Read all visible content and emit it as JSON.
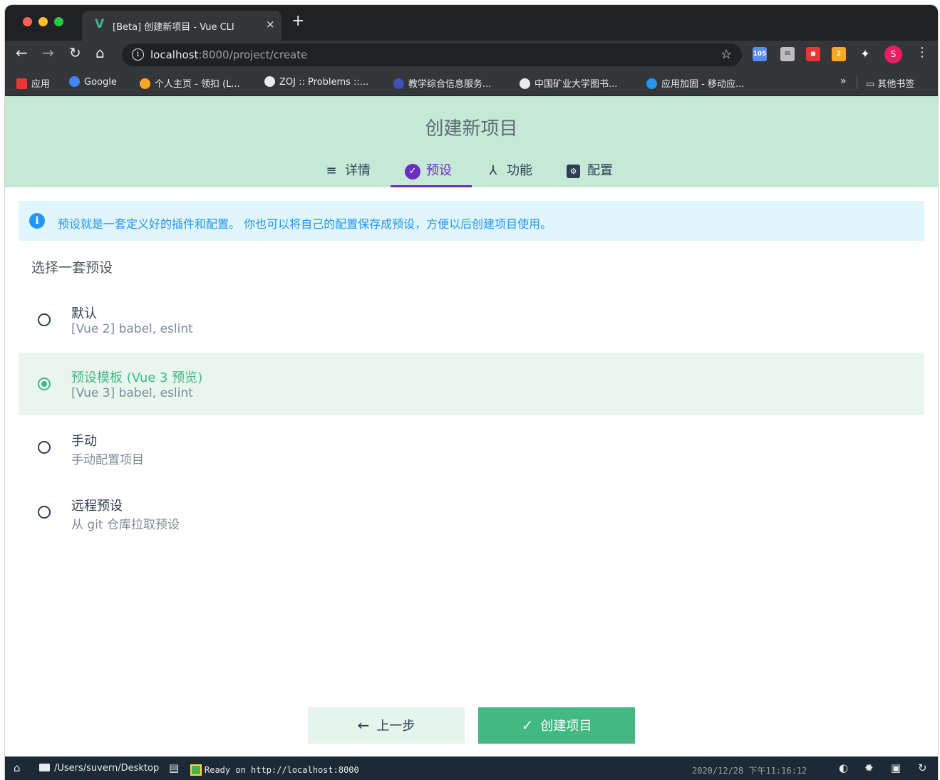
{
  "browser": {
    "tab_title": "[Beta] 创建新项目 - Vue CLI",
    "tab_favicon": "V",
    "tab_close": "×",
    "new_tab": "+",
    "url_host": "localhost",
    "url_path": ":8000/project/create",
    "avatar_letter": "S",
    "ext_badge": "105",
    "ext_badge_2": "2",
    "bookmarks": [
      {
        "label": "应用",
        "color": "#e53935"
      },
      {
        "label": "Google",
        "color": "#4285f4"
      },
      {
        "label": "个人主页 - 领扣 (L...",
        "color": "#f9a825"
      },
      {
        "label": "ZOJ :: Problems ::...",
        "color": "#e8eaed"
      },
      {
        "label": "教学综合信息服务...",
        "color": "#3f51b5"
      },
      {
        "label": "中国矿业大学图书...",
        "color": "#e8eaed"
      },
      {
        "label": "应用加固 - 移动应...",
        "color": "#2196f3"
      }
    ],
    "bookmarks_more": "»",
    "bookmarks_other": "其他书签"
  },
  "page": {
    "title": "创建新项目",
    "steps": [
      {
        "label": "详情",
        "icon": "details-icon"
      },
      {
        "label": "预设",
        "icon": "check-circle-icon"
      },
      {
        "label": "功能",
        "icon": "fork-icon"
      },
      {
        "label": "配置",
        "icon": "settings-box-icon"
      }
    ],
    "active_step": 1,
    "banner": "预设就是一套定义好的插件和配置。 你也可以将自己的配置保存成预设，方便以后创建项目使用。",
    "section_title": "选择一套预设",
    "presets": [
      {
        "name": "默认",
        "desc": "[Vue 2] babel, eslint",
        "selected": false
      },
      {
        "name": "预设模板 (Vue 3 预览)",
        "desc": "[Vue 3] babel, eslint",
        "selected": true
      },
      {
        "name": "手动",
        "desc": "手动配置项目",
        "selected": false
      },
      {
        "name": "远程预设",
        "desc": "从 git 仓库拉取预设",
        "selected": false
      }
    ],
    "prev_button": "上一步",
    "create_button": "创建项目"
  },
  "statusbar": {
    "path": "/Users/suvern/Desktop",
    "log": "Ready on http://localhost:8000",
    "time": "2020/12/28 下午11:16:12"
  },
  "colors": {
    "accent_green": "#42b983",
    "accent_purple": "#6a2ec2",
    "header_bg": "#c5e8d7",
    "info_blue": "#2196f3"
  }
}
